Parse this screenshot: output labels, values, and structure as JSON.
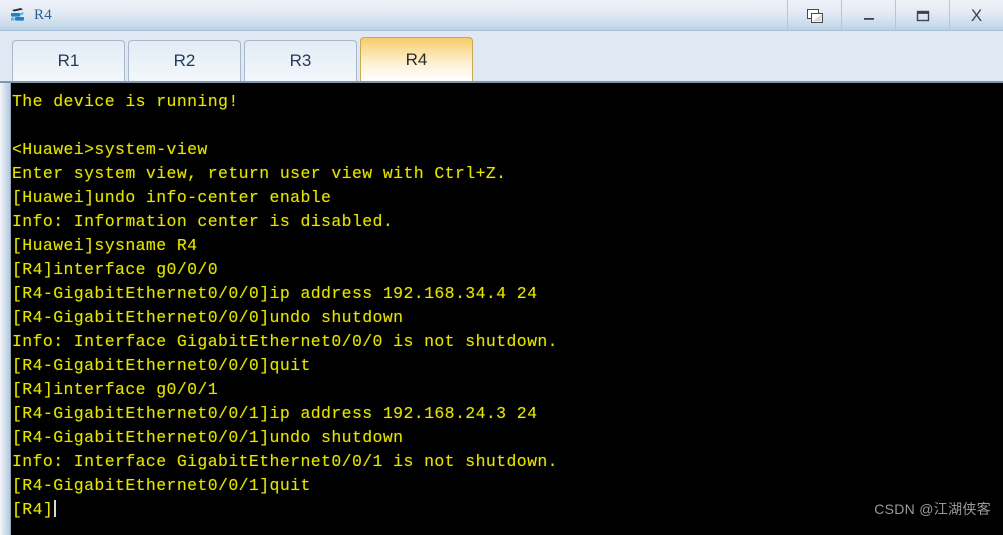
{
  "window": {
    "title": "R4",
    "icon": "router-device-icon",
    "controls": [
      {
        "name": "restore-button",
        "glyph": "restore-icon",
        "label": "Restore"
      },
      {
        "name": "minimize-button",
        "glyph": "minimize-icon",
        "label": "_"
      },
      {
        "name": "maximize-button",
        "glyph": "maximize-icon",
        "label": "▭"
      },
      {
        "name": "close-button",
        "glyph": "close-icon",
        "label": "X"
      }
    ]
  },
  "tabs": [
    {
      "label": "R1",
      "active": false
    },
    {
      "label": "R2",
      "active": false
    },
    {
      "label": "R3",
      "active": false
    },
    {
      "label": "R4",
      "active": true
    }
  ],
  "terminal": {
    "foreground": "#e5e500",
    "background": "#000000",
    "lines": [
      "The device is running!",
      "",
      "<Huawei>system-view",
      "Enter system view, return user view with Ctrl+Z.",
      "[Huawei]undo info-center enable",
      "Info: Information center is disabled.",
      "[Huawei]sysname R4",
      "[R4]interface g0/0/0",
      "[R4-GigabitEthernet0/0/0]ip address 192.168.34.4 24",
      "[R4-GigabitEthernet0/0/0]undo shutdown",
      "Info: Interface GigabitEthernet0/0/0 is not shutdown.",
      "[R4-GigabitEthernet0/0/0]quit",
      "[R4]interface g0/0/1",
      "[R4-GigabitEthernet0/0/1]ip address 192.168.24.3 24",
      "[R4-GigabitEthernet0/0/1]undo shutdown",
      "Info: Interface GigabitEthernet0/0/1 is not shutdown.",
      "[R4-GigabitEthernet0/0/1]quit"
    ],
    "prompt": "[R4]"
  },
  "watermark": "CSDN @江湖侠客"
}
